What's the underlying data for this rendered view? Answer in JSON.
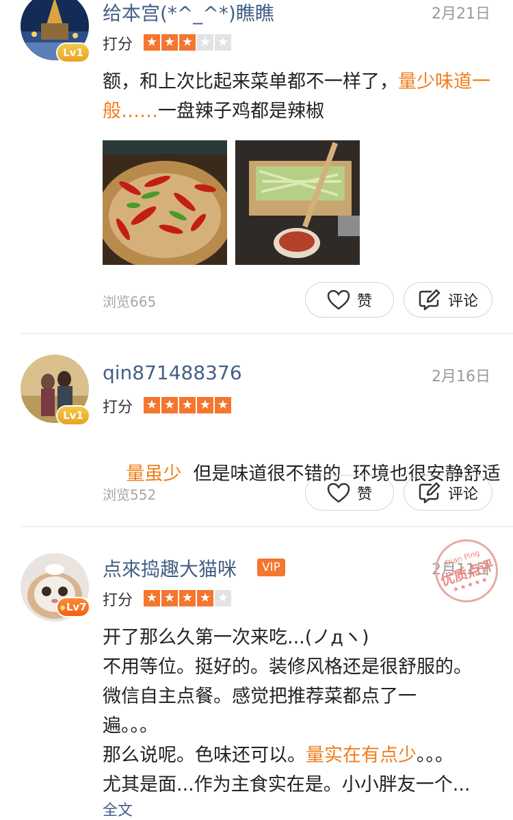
{
  "reviews": [
    {
      "username": "给本宫(*^_^*)瞧瞧",
      "level": "Lv1",
      "date": "2月21日",
      "rating_label": "打分",
      "rating": 3,
      "text_plain": "额，和上次比起来菜单都不一样了，",
      "text_highlight": "量少味道一般……",
      "text_tail": "一盘辣子鸡都是辣椒",
      "views": "浏览665",
      "like_label": "赞",
      "comment_label": "评论"
    },
    {
      "username": "qin871488376",
      "level": "Lv1",
      "date": "2月16日",
      "rating_label": "打分",
      "rating": 5,
      "text_highlight": "量虽少",
      "text_tail": "  但是味道很不错的  环境也很安静舒适",
      "views": "浏览552",
      "like_label": "赞",
      "comment_label": "评论"
    },
    {
      "username": "点來捣趣大猫咪",
      "badge": "VIP",
      "level": "Lv7",
      "date": "2月11日",
      "rating_label": "打分",
      "rating": 4,
      "stamp_top": "Dian Ping",
      "stamp_main": "优质点评",
      "stamp_bottom": "★★★★★",
      "lines": [
        "开了那么久第一次来吃...(ノдヽ)",
        "不用等位。挺好的。装修风格还是很舒服的。",
        "微信自主点餐。感觉把推荐菜都点了一",
        "遍。。。"
      ],
      "line5_plain": "那么说呢。色味还可以。",
      "line5_highlight": "量实在有点少",
      "line5_tail": "。。。",
      "line6": "尤其是面...作为主食实在是。小小胖友一个...",
      "more_label": "全文"
    }
  ],
  "colors": {
    "username": "#435f86",
    "accent": "#f5762e",
    "highlight": "#f07d1a",
    "muted": "#999999"
  },
  "icons": {
    "like": "heart-outline-icon",
    "comment": "edit-comment-icon",
    "star": "star-icon"
  }
}
